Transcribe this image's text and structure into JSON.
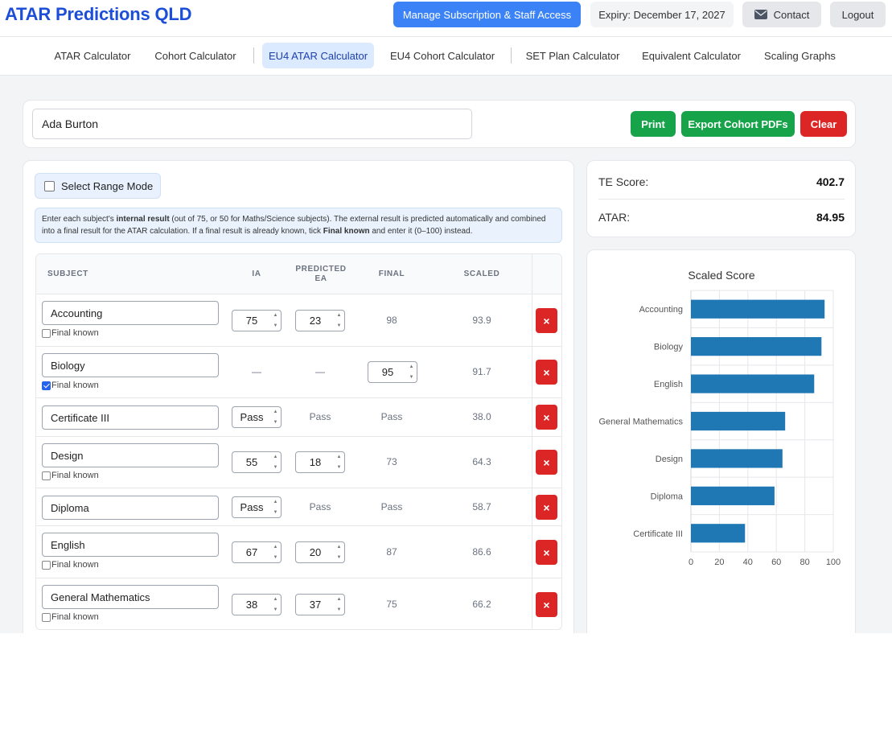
{
  "header": {
    "brand": "ATAR Predictions QLD",
    "manage_label": "Manage Subscription & Staff Access",
    "expiry_label": "Expiry: December 17, 2027",
    "contact_label": "Contact",
    "logout_label": "Logout"
  },
  "nav": {
    "tabs": [
      {
        "label": "ATAR Calculator"
      },
      {
        "label": "Cohort Calculator"
      },
      {
        "label": "EU4 ATAR Calculator"
      },
      {
        "label": "EU4 Cohort Calculator"
      },
      {
        "label": "SET Plan Calculator"
      },
      {
        "label": "Equivalent Calculator"
      },
      {
        "label": "Scaling Graphs"
      }
    ],
    "active_tab": "EU4 ATAR Calculator"
  },
  "student": {
    "name_value": "Ada Burton",
    "print_label": "Print",
    "export_label": "Export Cohort PDFs",
    "clear_label": "Clear"
  },
  "range_mode": {
    "label": "Select Range Mode",
    "checked": false
  },
  "info": {
    "p1": "Enter each subject's ",
    "b1": "internal result",
    "p2": " (out of 75, or 50 for Maths/Science subjects). The external result is predicted automatically and combined into a final result for the ATAR calculation. If a final result is already known, tick ",
    "b2": "Final known",
    "p3": " and enter it (0–100) instead."
  },
  "table": {
    "headers": {
      "subject": "SUBJECT",
      "ia": "IA",
      "predicted_ea": "PREDICTED EA",
      "final": "FINAL",
      "scaled": "SCALED"
    },
    "final_known_label": "Final known",
    "delete_symbol": "×",
    "rows": [
      {
        "subject": "Accounting",
        "ia": "75",
        "ea": "23",
        "final": "98",
        "scaled": "93.9",
        "final_known": false,
        "has_checkbox": true
      },
      {
        "subject": "Biology",
        "ia": "—",
        "ea": "—",
        "final": "95",
        "scaled": "91.7",
        "final_known": true,
        "has_checkbox": true
      },
      {
        "subject": "Certificate III",
        "ia": "Pass",
        "ea": "Pass",
        "final": "Pass",
        "scaled": "38.0",
        "final_known": false,
        "has_checkbox": false
      },
      {
        "subject": "Design",
        "ia": "55",
        "ea": "18",
        "final": "73",
        "scaled": "64.3",
        "final_known": false,
        "has_checkbox": true
      },
      {
        "subject": "Diploma",
        "ia": "Pass",
        "ea": "Pass",
        "final": "Pass",
        "scaled": "58.7",
        "final_known": false,
        "has_checkbox": false
      },
      {
        "subject": "English",
        "ia": "67",
        "ea": "20",
        "final": "87",
        "scaled": "86.6",
        "final_known": false,
        "has_checkbox": true
      },
      {
        "subject": "General Mathematics",
        "ia": "38",
        "ea": "37",
        "final": "75",
        "scaled": "66.2",
        "final_known": false,
        "has_checkbox": true
      }
    ]
  },
  "results": {
    "te_label": "TE Score:",
    "te_value": "402.7",
    "atar_label": "ATAR:",
    "atar_value": "84.95"
  },
  "chart_data": {
    "type": "bar",
    "orientation": "horizontal",
    "title": "Scaled Score",
    "categories": [
      "Accounting",
      "Biology",
      "English",
      "General Mathematics",
      "Design",
      "Diploma",
      "Certificate III"
    ],
    "values": [
      93.9,
      91.7,
      86.6,
      66.2,
      64.3,
      58.7,
      38.0
    ],
    "xlim": [
      0,
      100
    ],
    "xticks": [
      0,
      20,
      40,
      60,
      80,
      100
    ],
    "grid": true,
    "bar_color": "#1f77b4"
  },
  "colors": {
    "brand": "#1d4ed8",
    "primary": "#3b82f6",
    "success": "#16a34a",
    "danger": "#dc2626",
    "bar": "#1f77b4"
  }
}
